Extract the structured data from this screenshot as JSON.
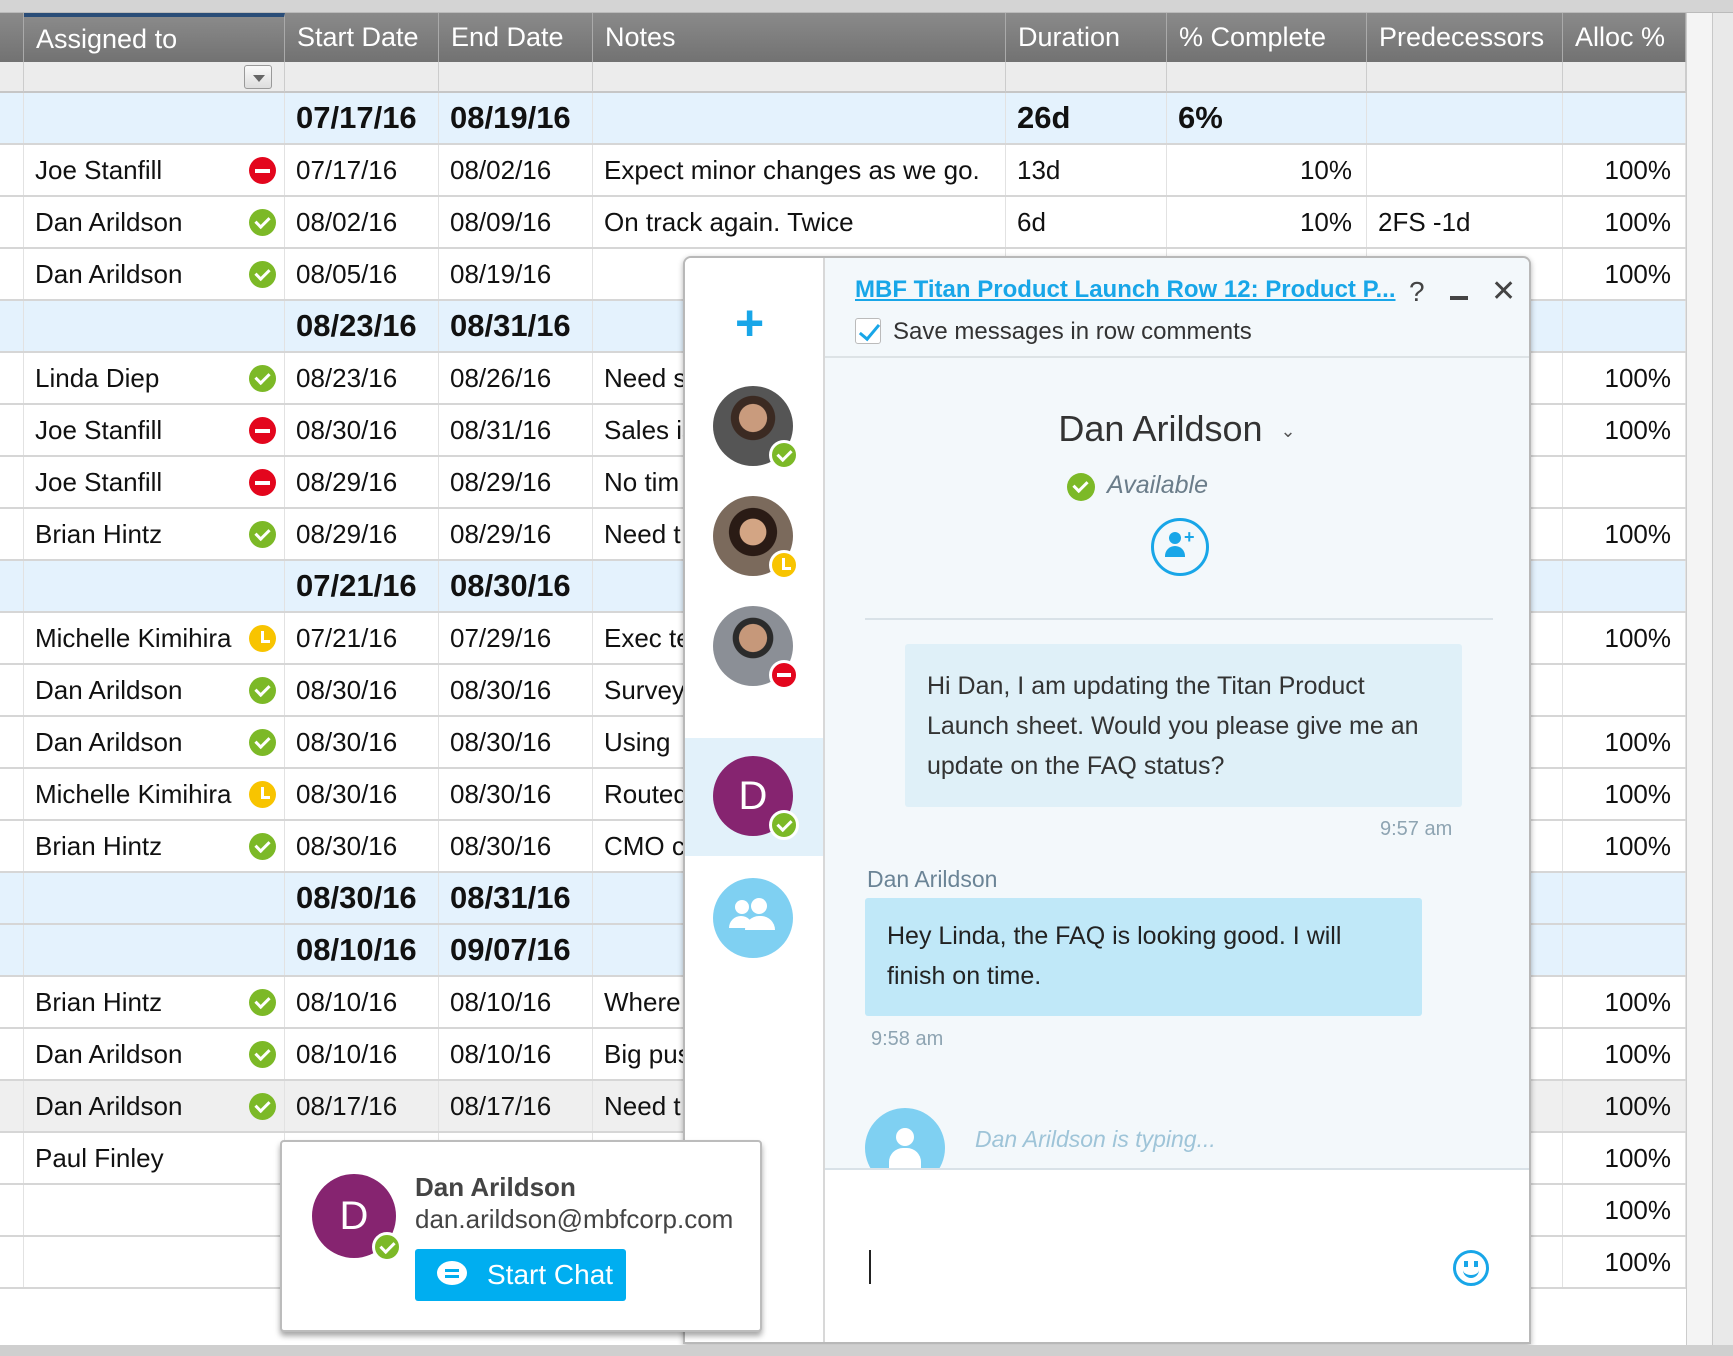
{
  "columns": [
    "Assigned to",
    "Start Date",
    "End Date",
    "Notes",
    "Duration",
    "% Complete",
    "Predecessors",
    "Alloc %"
  ],
  "rows": [
    {
      "parent": true,
      "start": "07/17/16",
      "end": "08/19/16",
      "duration": "26d",
      "pct": "6%"
    },
    {
      "name": "Joe Stanfill",
      "status": "busy",
      "start": "07/17/16",
      "end": "08/02/16",
      "notes": "Expect minor changes as we go.",
      "duration": "13d",
      "pct": "10%",
      "alloc": "100%"
    },
    {
      "name": "Dan Arildson",
      "status": "ok",
      "start": "08/02/16",
      "end": "08/09/16",
      "notes": "On track again. Twice",
      "duration": "6d",
      "pct": "10%",
      "pred": "2FS -1d",
      "alloc": "100%"
    },
    {
      "name": "Dan Arildson",
      "status": "ok",
      "start": "08/05/16",
      "end": "08/19/16",
      "alloc": "100%"
    },
    {
      "parent": true,
      "start": "08/23/16",
      "end": "08/31/16"
    },
    {
      "name": "Linda Diep",
      "status": "ok",
      "start": "08/23/16",
      "end": "08/26/16",
      "notes": "Need s",
      "alloc": "100%"
    },
    {
      "name": "Joe Stanfill",
      "status": "busy",
      "start": "08/30/16",
      "end": "08/31/16",
      "notes": "Sales is",
      "alloc": "100%"
    },
    {
      "name": "Joe Stanfill",
      "status": "busy",
      "start": "08/29/16",
      "end": "08/29/16",
      "notes": "No tim"
    },
    {
      "name": "Brian Hintz",
      "status": "ok",
      "start": "08/29/16",
      "end": "08/29/16",
      "notes": "Need t",
      "alloc": "100%"
    },
    {
      "parent": true,
      "start": "07/21/16",
      "end": "08/30/16"
    },
    {
      "name": "Michelle Kimihira",
      "status": "away",
      "start": "07/21/16",
      "end": "07/29/16",
      "notes": "Exec te",
      "alloc": "100%"
    },
    {
      "name": "Dan Arildson",
      "status": "ok",
      "start": "08/30/16",
      "end": "08/30/16",
      "notes": "Survey"
    },
    {
      "name": "Dan Arildson",
      "status": "ok",
      "start": "08/30/16",
      "end": "08/30/16",
      "notes": "Using",
      "alloc": "100%"
    },
    {
      "name": "Michelle Kimihira",
      "status": "away",
      "start": "08/30/16",
      "end": "08/30/16",
      "notes": "Routed",
      "alloc": "100%"
    },
    {
      "name": "Brian Hintz",
      "status": "ok",
      "start": "08/30/16",
      "end": "08/30/16",
      "notes": "CMO c",
      "alloc": "100%"
    },
    {
      "parent": true,
      "start": "08/30/16",
      "end": "08/31/16"
    },
    {
      "parent": true,
      "start": "08/10/16",
      "end": "09/07/16"
    },
    {
      "name": "Brian Hintz",
      "status": "ok",
      "start": "08/10/16",
      "end": "08/10/16",
      "notes": "Where",
      "alloc": "100%"
    },
    {
      "name": "Dan Arildson",
      "status": "ok",
      "start": "08/10/16",
      "end": "08/10/16",
      "notes": "Big pus",
      "alloc": "100%"
    },
    {
      "name": "Dan Arildson",
      "status": "ok",
      "start": "08/17/16",
      "end": "08/17/16",
      "notes": "Need t",
      "alloc": "100%",
      "highlight": true
    },
    {
      "name": "Paul Finley",
      "alloc": "100%"
    },
    {
      "alloc": "100%"
    },
    {
      "alloc": "100%"
    }
  ],
  "chat": {
    "title": "MBF Titan Product Launch Row 12: Product P...",
    "help": "?",
    "close": "✕",
    "save_label": "Save messages in row comments",
    "save_checked": true,
    "contact_name": "Dan Arildson",
    "contact_caret": "⌄",
    "presence": "Available",
    "add_person_plus": "+",
    "new_chat": "+",
    "rail_letter": "D",
    "messages": [
      {
        "text": "Hi Dan, I am updating the Titan Product Launch sheet. Would you please give me an update on the FAQ status?",
        "time": "9:57 am"
      },
      {
        "sender": "Dan Arildson",
        "text": "Hey Linda, the FAQ is looking good. I will finish on time.",
        "time": "9:58 am"
      }
    ],
    "typing": "Dan Arildson is typing..."
  },
  "card": {
    "letter": "D",
    "name": "Dan Arildson",
    "email": "dan.arildson@mbfcorp.com",
    "button": "Start Chat"
  },
  "colors": {
    "accent": "#18a6e8",
    "available": "#7cb927",
    "busy": "#e3061d",
    "away": "#f8c400",
    "avatar_purple": "#862470"
  }
}
